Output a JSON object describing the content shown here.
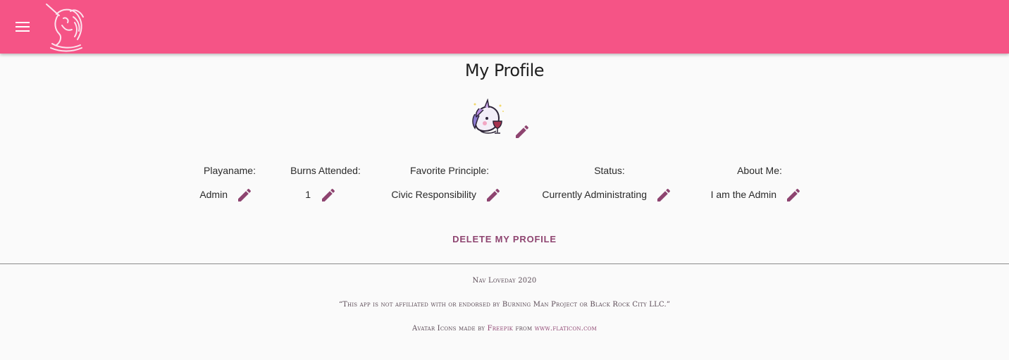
{
  "header": {
    "menu_icon": "menu-icon",
    "logo_icon": "unicorn-logo-icon",
    "bar_color": "#f55486"
  },
  "profile": {
    "title": "My Profile",
    "avatar_icon": "unicorn-avatar-icon",
    "fields": [
      {
        "label": "Playaname:",
        "value": "Admin"
      },
      {
        "label": "Burns Attended:",
        "value": "1"
      },
      {
        "label": "Favorite Principle:",
        "value": "Civic Responsibility"
      },
      {
        "label": "Status:",
        "value": "Currently Administrating"
      },
      {
        "label": "About Me:",
        "value": "I am the Admin"
      }
    ],
    "delete_label": "DELETE MY PROFILE",
    "accent_color": "#8e4470"
  },
  "footer": {
    "credit": "Nav Loveday 2020",
    "disclaimer": "“This app is not affiliated with or endorsed by Burning Man Project or Black Rock City LLC.”",
    "icons_prefix": "Avatar Icons made by",
    "icons_author": "Freepik",
    "icons_from": "from",
    "icons_site": "www.flaticon.com"
  }
}
